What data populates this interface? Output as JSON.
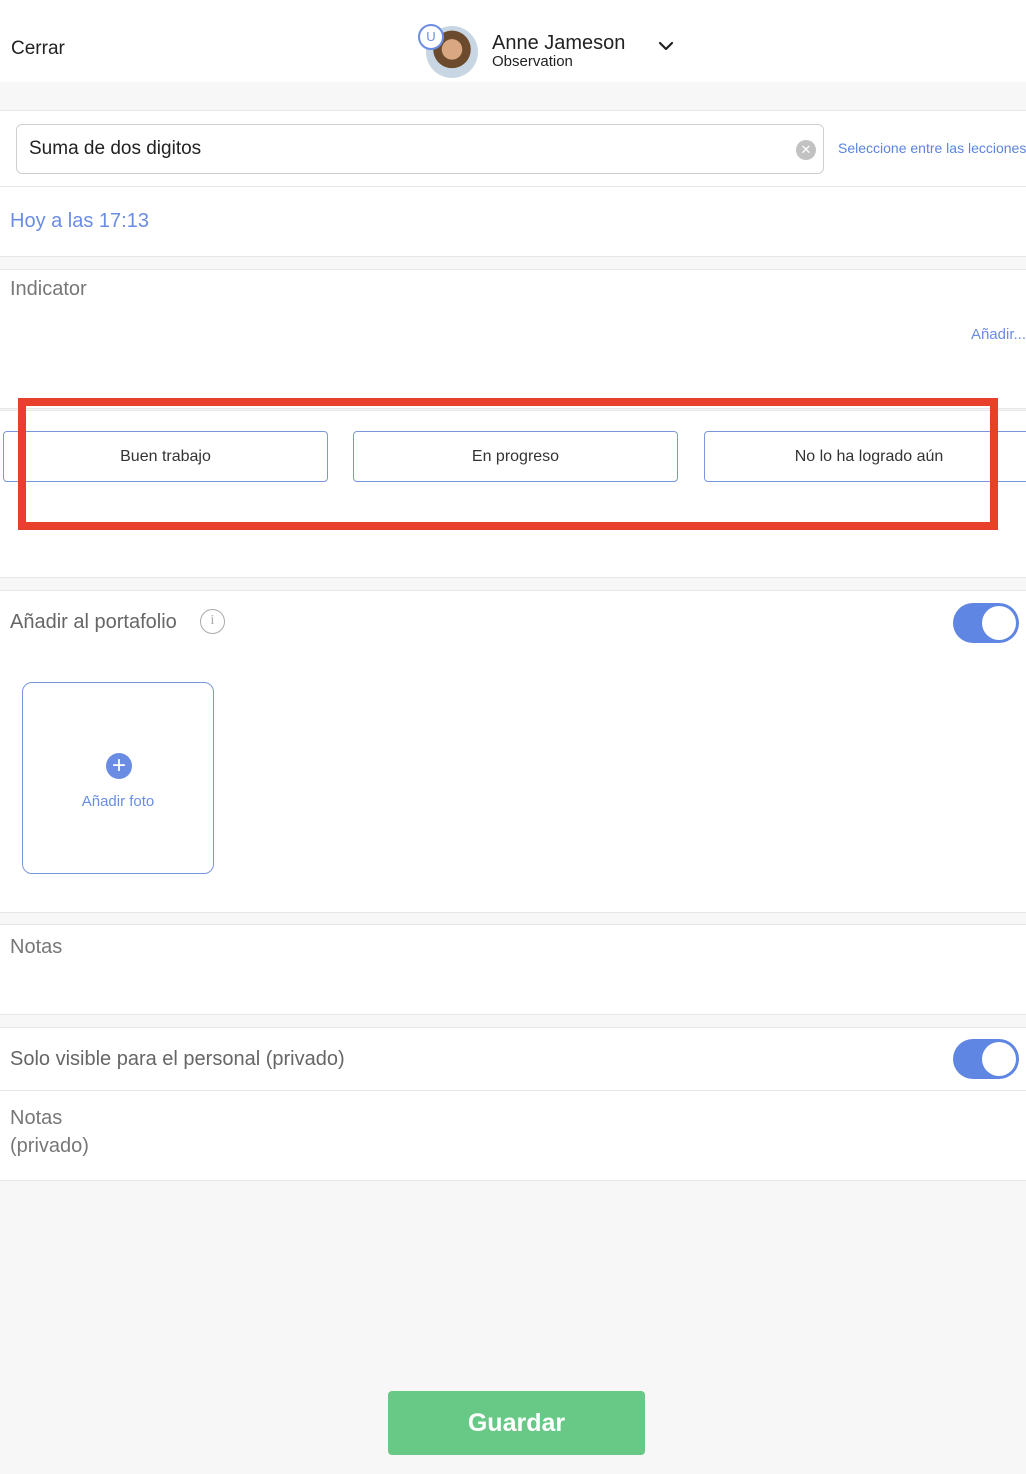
{
  "header": {
    "close_label": "Cerrar",
    "student_name": "Anne Jameson",
    "student_subtitle": "Observation",
    "avatar_badge": "U"
  },
  "lesson": {
    "value": "Suma de dos digitos",
    "select_link": "Seleccione entre las lecciones"
  },
  "date": {
    "label": "Hoy a las 17:13"
  },
  "indicator": {
    "label": "Indicator",
    "add_link": "Añadir..."
  },
  "ratings": [
    {
      "label": "Buen trabajo"
    },
    {
      "label": "En progreso"
    },
    {
      "label": "No lo ha logrado aún"
    }
  ],
  "portfolio": {
    "label": "Añadir al portafolio",
    "toggle_on": true,
    "add_photo_label": "Añadir foto"
  },
  "notes": {
    "label": "Notas"
  },
  "private": {
    "label": "Solo visible para el personal (privado)",
    "toggle_on": true,
    "notes_label_line1": "Notas",
    "notes_label_line2": "(privado)"
  },
  "footer": {
    "save_label": "Guardar"
  },
  "colors": {
    "accent": "#6a8de3",
    "save": "#67c985",
    "highlight": "#e8402a"
  }
}
